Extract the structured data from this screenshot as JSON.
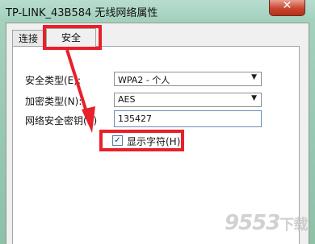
{
  "window": {
    "title": "TP-LINK_43B584 无线网络属性",
    "close_label": "✕"
  },
  "tabs": [
    {
      "label": "连接",
      "active": false
    },
    {
      "label": "安全",
      "active": true
    }
  ],
  "security": {
    "type_label": "安全类型(E):",
    "type_value": "WPA2 - 个人",
    "encryption_label": "加密类型(N):",
    "encryption_value": "AES",
    "key_label": "网络安全密钥(K)",
    "key_value": "135427",
    "show_chars_label": "显示字符(H)",
    "show_chars_checked": true
  },
  "watermark": {
    "text": "9553",
    "suffix": "下载"
  },
  "colors": {
    "highlight": "#e8202a",
    "titlebar": "#a2d0bd",
    "close": "#c9452f"
  }
}
